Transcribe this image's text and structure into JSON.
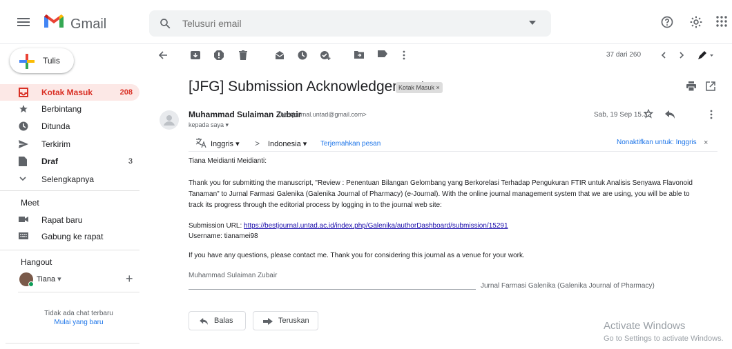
{
  "app": {
    "name": "Gmail"
  },
  "search": {
    "placeholder": "Telusuri email"
  },
  "compose": {
    "label": "Tulis"
  },
  "sidebar": {
    "items": [
      {
        "label": "Kotak Masuk",
        "count": "208"
      },
      {
        "label": "Berbintang",
        "count": ""
      },
      {
        "label": "Ditunda",
        "count": ""
      },
      {
        "label": "Terkirim",
        "count": ""
      },
      {
        "label": "Draf",
        "count": "3"
      },
      {
        "label": "Selengkapnya",
        "count": ""
      }
    ],
    "meet": {
      "title": "Meet",
      "items": [
        "Rapat baru",
        "Gabung ke rapat"
      ]
    },
    "hangout": {
      "title": "Hangout",
      "user": "Tiana",
      "no_chat": "Tidak ada chat terbaru",
      "start_new": "Mulai yang baru"
    }
  },
  "toolbar": {
    "pagination": "37 dari 260"
  },
  "message": {
    "subject": "[JFG] Submission Acknowledgement",
    "label": "Kotak Masuk ×",
    "sender_name": "Muhammad Sulaiman Zubair",
    "sender_email": "<bestjournal.untad@gmail.com>",
    "to": "kepada saya ▾",
    "date": "Sab, 19 Sep 15.32",
    "translate": {
      "from": "Inggris",
      "arrow": ">",
      "to": "Indonesia",
      "action": "Terjemahkan pesan",
      "disable": "Nonaktifkan untuk: Inggris"
    },
    "greeting": "Tiana Meidianti Meidianti:",
    "para1_line1": "Thank you for submitting the manuscript, \"Review : Penentuan Bilangan Gelombang yang Berkorelasi Terhadap Pengukuran FTIR untuk Analisis Senyawa Flavonoid",
    "para1_line2": "Tanaman\" to Jurnal Farmasi Galenika (Galenika Journal of Pharmacy) (e-Journal). With the online journal management system that we are using, you will be able to",
    "para1_line3": "track its progress through the editorial process by logging in to the journal web site:",
    "submission_label": "Submission URL: ",
    "submission_url": "https://bestjournal.untad.ac.id/index.php/Galenika/authorDashboard/submission/15291",
    "username": "Username: tianamei98",
    "para2": "If you have any questions, please contact me. Thank you for considering this journal as a venue for your work.",
    "signature_name": "Muhammad Sulaiman Zubair",
    "signature_journal": "Jurnal Farmasi Galenika (Galenika Journal of Pharmacy)"
  },
  "actions": {
    "reply": "Balas",
    "forward": "Teruskan"
  },
  "watermark": {
    "title": "Activate Windows",
    "subtitle": "Go to Settings to activate Windows."
  },
  "colors": {
    "accent_red": "#d93025",
    "active_bg": "#fce8e6",
    "link": "#1a0dab"
  }
}
